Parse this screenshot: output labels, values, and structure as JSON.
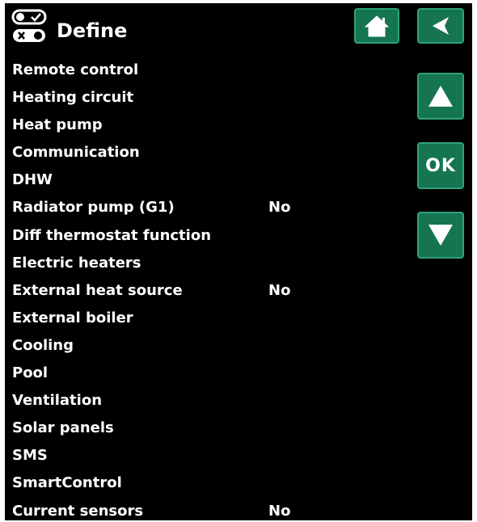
{
  "header": {
    "title": "Define",
    "icon": "toggle-settings-icon",
    "home_icon": "home-icon",
    "back_icon": "back-arrow-icon"
  },
  "nav": {
    "up_icon": "up-arrow-icon",
    "ok_label": "OK",
    "down_icon": "down-arrow-icon"
  },
  "menu": {
    "items": [
      {
        "label": "Remote control",
        "value": ""
      },
      {
        "label": "Heating circuit",
        "value": ""
      },
      {
        "label": "Heat pump",
        "value": ""
      },
      {
        "label": "Communication",
        "value": ""
      },
      {
        "label": "DHW",
        "value": ""
      },
      {
        "label": "Radiator pump (G1)",
        "value": "No"
      },
      {
        "label": "Diff thermostat function",
        "value": ""
      },
      {
        "label": "Electric heaters",
        "value": ""
      },
      {
        "label": "External heat source",
        "value": "No"
      },
      {
        "label": "External boiler",
        "value": ""
      },
      {
        "label": "Cooling",
        "value": ""
      },
      {
        "label": "Pool",
        "value": ""
      },
      {
        "label": "Ventilation",
        "value": ""
      },
      {
        "label": "Solar panels",
        "value": ""
      },
      {
        "label": "SMS",
        "value": ""
      },
      {
        "label": "SmartControl",
        "value": ""
      },
      {
        "label": "Current sensors",
        "value": "No"
      }
    ]
  },
  "colors": {
    "background": "#000000",
    "text": "#ffffff",
    "button_fill": "#157550",
    "button_border": "#2fa27a"
  }
}
